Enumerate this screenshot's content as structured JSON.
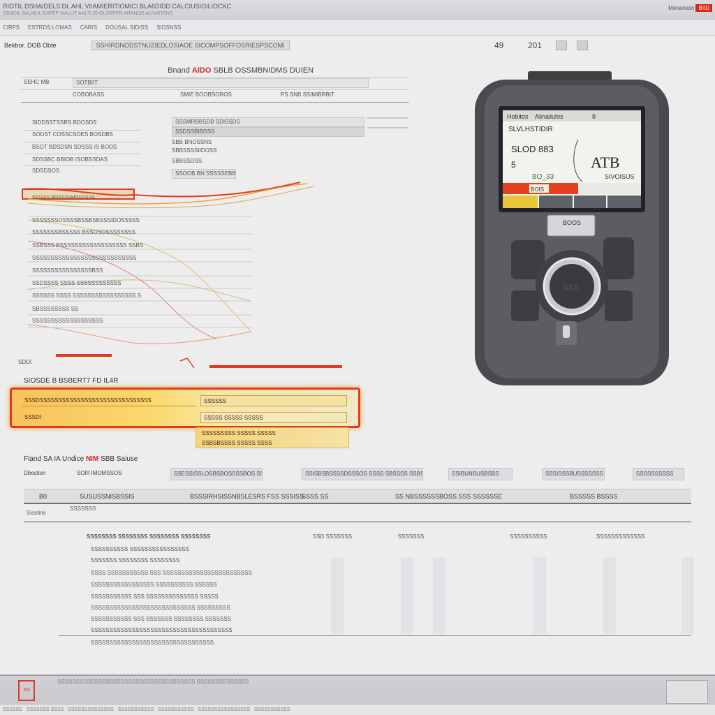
{
  "window": {
    "title": "RIOTIL DSHAIDELS DL AHL VIIAMIERITIOMICI BLA6DIDD CALCIUSIOILIOCKC",
    "subtitle": "CRADIL SALMUL GATEP MALLIT AALTLID OLDRPPR ARANOS ALNATIONS",
    "right_label": "Monariasn",
    "right_badge": "BIID"
  },
  "menubar": [
    "CIRFS",
    "ESTRDS LOMAS",
    "CARIS",
    "DOUSAL SIDISS",
    "SIDSNSS"
  ],
  "toolbar": {
    "left_label": "Bekbor. DOB Obte",
    "search_text": "SSHIRDNODSTNUZIEDLOSIAOE SICOMPSOFFOSRIESPSCOMI",
    "zoom": "49",
    "page": "201"
  },
  "panel": {
    "title_prefix": "Bnand",
    "title_red": "AIDO",
    "title_rest": "SBLB OSSMBNIDMS DUIEN",
    "row1_label": "SEHC MB",
    "row1_value": "SOTBIIT",
    "row2_left": "COBOBASS",
    "row2_mid": "SMIE BOOBSOROS",
    "row2_right": "PS SNB SSIMIBRBIT",
    "list_left": [
      "SIDDSSTSSRS BDOSDS",
      "SODST COSSCSOES BOSDBS",
      "BSOT BDSDSN SDSSS IS BODS",
      "SDSSBC BBIOB ISOBSSDAS",
      "SDSDSOS"
    ],
    "list_right": [
      "SSSMRBBSDB SDISSDS",
      "SSDSSBIBDSS",
      "SBB BNOSSNS",
      "SBBSSSSIIDOSS",
      "SBBSSDSS",
      "SSOOB BN SSSSSEBBS"
    ]
  },
  "signal_list": [
    "SSSSIS BOSSSSMSSSSSS",
    "SSSSSSSOSSSSBSSBSBSSSIDOSSSSS",
    "SSSSSSSBSSSSS BSSOSOSSSSSSSS",
    "SSBSSS BSSSSSSSSSSSSSSSSSS SSBS",
    "SSSSSSSSSSSSSSSSSSSSSSSSSSSS",
    "SSSSSSSSSSSSSSSSBSS",
    "SSDSSSS SSSS SSSSSSSSSSSS",
    "SSSSSS SSSS SSSSSSSSSSSSSSSSS S",
    "SBSSSSSSSS SS",
    "SSSSSSSSSSSSSSSSSSS"
  ],
  "signal_marker": "SDDI",
  "highlight": {
    "title": "SIOSDE B BSBERT7 FD IL4R",
    "rows_left": [
      "SSSDSSSSSSSSSSSSSSSSSSSSSSSSSSSSSS",
      "SSSDI"
    ],
    "rows_right": [
      "SSSSSS",
      "SSSSS SSSSS SSSSS",
      "SSSSSSSSS SSSSS SSSSS",
      "SSBSBSSSS SSSSS SSSS"
    ]
  },
  "device": {
    "header_left": "Hobitos",
    "header_mid": "Alinailuhis",
    "header_right": "8",
    "line1": "SLVLHSTIDIR",
    "line2": "SLOD 883",
    "line3": "5",
    "big": "ATB",
    "readout": "BO_33",
    "side": "SIVOISUS",
    "bar_label": "BOIS",
    "nameplate": "BOOS",
    "dial": "NTA"
  },
  "table": {
    "title_prefix": "Fland SA IA Undice",
    "title_red": "NIM",
    "title_rest": "SBB Saiuse",
    "chips": [
      "Dbestion",
      "SOIII IMOMSSOS",
      "SSESSISSLOSBSBOSSSSBOS SSOSSRI",
      "SSISBSBSSSSDSSSOS SSSS SBSSSS SSBSS",
      "SSIBUNSUSBSBS",
      "SSSISSSBUSSSSSSS",
      "SSSSSSSSSS"
    ],
    "header": [
      "B0",
      "SUSUSSNISBSSIS",
      "BSSSIRHSISSNBSLESRS FSS SSSISS",
      "SSSS SS",
      "SS NBSSSSSSBOSS SSS SSSSSSE",
      "BSSSSS BSSSS"
    ],
    "sub_left": "Sisstins",
    "sub_right": "SSSSSSS",
    "rows": [
      "SSSSSSSS SSSSSSSS SSSSSSSS SSSSSSSS",
      "SSSSSSSSSS SSSSSSSSSSSSSSSS",
      "SSSSSSS SSSSSSSS SSSSSSSS",
      "SSSS SSSSSSSSSSS SSS SSSSSSSSSSSSSSSSSSSSSSSS",
      "SSSSSSSSSSSSSSSSS SSSSSSSSSS SSSSSS",
      "SSSSSSSSSSS SSS SSSSSSSSSSSSSS SSSSS",
      "SSSSSSSSSSSSSSSSSSSSSSSSSSSS SSSSSSSSS",
      "SSSSSSSSSSS SSS SSSSSSS SSSSSSSS SSSSSSS",
      "SSSSSSSSSSSSSSSSSSSSSSSSSSSSSSSSSSSSSS",
      "SSSSSSSSSSSSSSSSSSSSSSSSSSSSSSSSS"
    ],
    "col2": "SSD SSSSSSS",
    "col3": "SSSSSSS",
    "col4": "SSSSSSSSSS",
    "col5": "SSSSSSSSSSSSS"
  },
  "footer": {
    "logo": "SS",
    "text": "SSSSSSSSSSSSSSSSSSSSSSSSSSSSSSSSSSSSS SSSSSSSSSSSSSS"
  },
  "status_items": [
    "SSSSSS",
    "SSSSSSS SSSS",
    "SSSSSSSSSSSSSS",
    "SSSSSSSSSSS",
    "SSSSSSSSSSS",
    "SSSSSSSSSSSSSSSS",
    "SSSSSSSSSSS"
  ],
  "colors": {
    "accent": "#d8281d",
    "highlight": "#f9c25c",
    "device_body": "#4a4b50"
  }
}
